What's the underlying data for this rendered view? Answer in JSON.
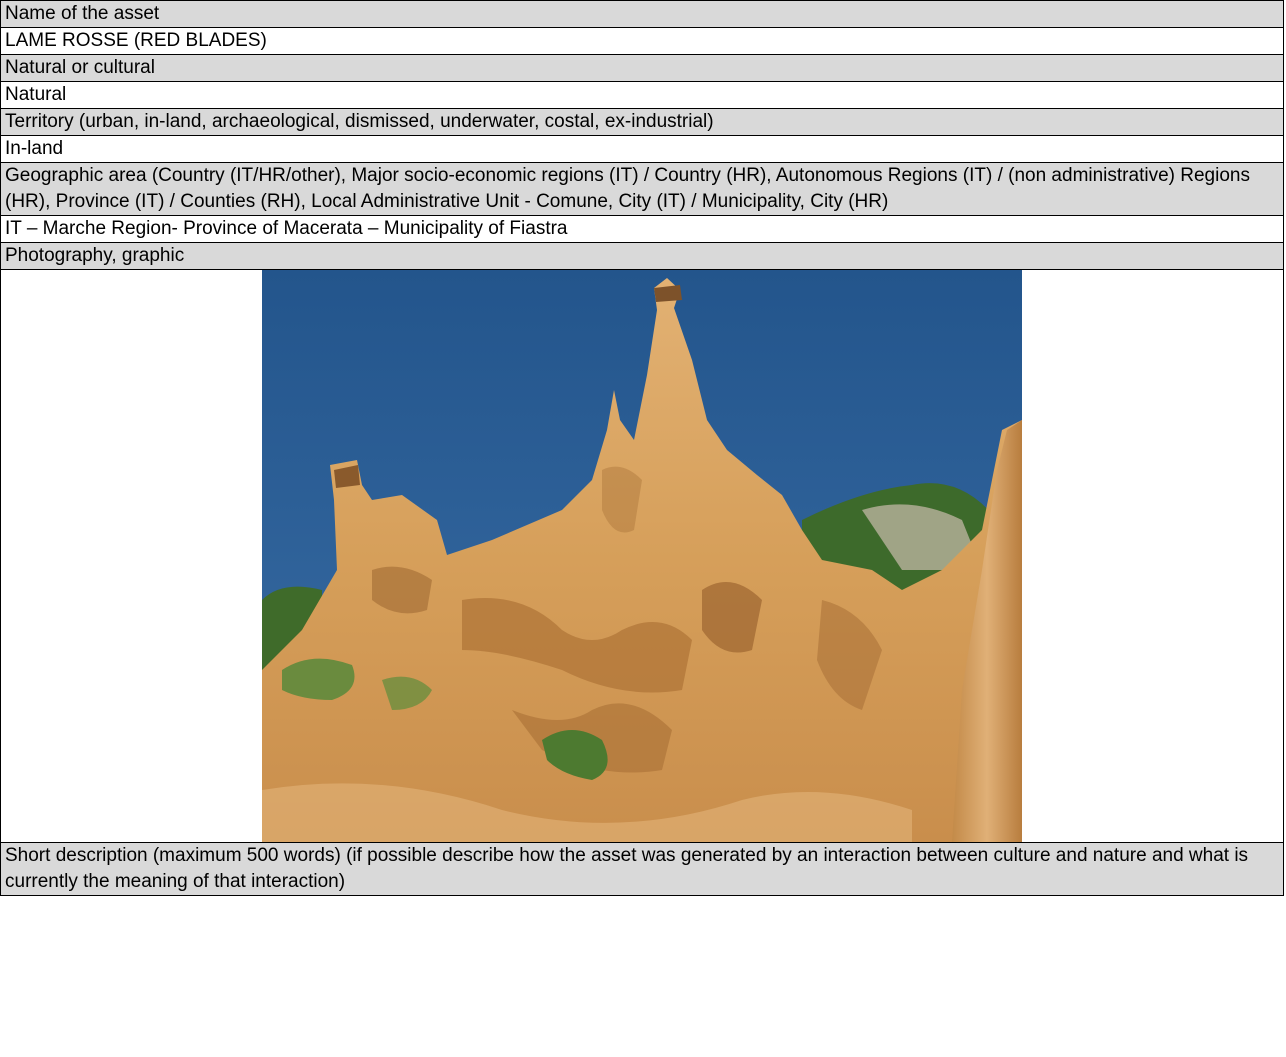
{
  "rows": [
    {
      "label": "Name of the asset"
    },
    {
      "value": "LAME ROSSE (RED BLADES)"
    },
    {
      "label": "Natural or cultural"
    },
    {
      "value": "Natural"
    },
    {
      "label": "Territory (urban, in-land, archaeological, dismissed, underwater, costal, ex-industrial)"
    },
    {
      "value": "In-land"
    },
    {
      "label": "Geographic area (Country (IT/HR/other), Major socio-economic regions (IT) / Country (HR), Autonomous Regions (IT) / (non administrative) Regions (HR), Province (IT) / Counties (RH), Local Administrative Unit - Comune, City (IT) / Municipality, City (HR)"
    },
    {
      "value": "IT – Marche Region- Province of Macerata – Municipality of Fiastra"
    },
    {
      "label": "Photography, graphic"
    },
    {
      "label": "Short description (maximum 500 words) (if possible describe how the asset was generated by an interaction between culture and nature and what is currently the meaning of that interaction)"
    }
  ],
  "photo": {
    "subject": "Lame Rosse sandstone pinnacles under a blue sky",
    "colors": {
      "sky": "#2b5f97",
      "rock": "#d9a45e",
      "shadow": "#a86f36",
      "vegetation": "#3f6b2a"
    }
  }
}
